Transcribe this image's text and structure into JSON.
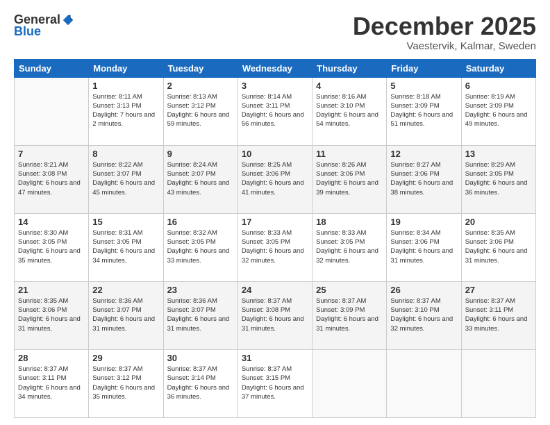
{
  "logo": {
    "general": "General",
    "blue": "Blue"
  },
  "header": {
    "month": "December 2025",
    "location": "Vaestervik, Kalmar, Sweden"
  },
  "weekdays": [
    "Sunday",
    "Monday",
    "Tuesday",
    "Wednesday",
    "Thursday",
    "Friday",
    "Saturday"
  ],
  "weeks": [
    [
      {
        "day": "",
        "sunrise": "",
        "sunset": "",
        "daylight": "",
        "empty": true
      },
      {
        "day": "1",
        "sunrise": "Sunrise: 8:11 AM",
        "sunset": "Sunset: 3:13 PM",
        "daylight": "Daylight: 7 hours and 2 minutes."
      },
      {
        "day": "2",
        "sunrise": "Sunrise: 8:13 AM",
        "sunset": "Sunset: 3:12 PM",
        "daylight": "Daylight: 6 hours and 59 minutes."
      },
      {
        "day": "3",
        "sunrise": "Sunrise: 8:14 AM",
        "sunset": "Sunset: 3:11 PM",
        "daylight": "Daylight: 6 hours and 56 minutes."
      },
      {
        "day": "4",
        "sunrise": "Sunrise: 8:16 AM",
        "sunset": "Sunset: 3:10 PM",
        "daylight": "Daylight: 6 hours and 54 minutes."
      },
      {
        "day": "5",
        "sunrise": "Sunrise: 8:18 AM",
        "sunset": "Sunset: 3:09 PM",
        "daylight": "Daylight: 6 hours and 51 minutes."
      },
      {
        "day": "6",
        "sunrise": "Sunrise: 8:19 AM",
        "sunset": "Sunset: 3:09 PM",
        "daylight": "Daylight: 6 hours and 49 minutes."
      }
    ],
    [
      {
        "day": "7",
        "sunrise": "Sunrise: 8:21 AM",
        "sunset": "Sunset: 3:08 PM",
        "daylight": "Daylight: 6 hours and 47 minutes."
      },
      {
        "day": "8",
        "sunrise": "Sunrise: 8:22 AM",
        "sunset": "Sunset: 3:07 PM",
        "daylight": "Daylight: 6 hours and 45 minutes."
      },
      {
        "day": "9",
        "sunrise": "Sunrise: 8:24 AM",
        "sunset": "Sunset: 3:07 PM",
        "daylight": "Daylight: 6 hours and 43 minutes."
      },
      {
        "day": "10",
        "sunrise": "Sunrise: 8:25 AM",
        "sunset": "Sunset: 3:06 PM",
        "daylight": "Daylight: 6 hours and 41 minutes."
      },
      {
        "day": "11",
        "sunrise": "Sunrise: 8:26 AM",
        "sunset": "Sunset: 3:06 PM",
        "daylight": "Daylight: 6 hours and 39 minutes."
      },
      {
        "day": "12",
        "sunrise": "Sunrise: 8:27 AM",
        "sunset": "Sunset: 3:06 PM",
        "daylight": "Daylight: 6 hours and 38 minutes."
      },
      {
        "day": "13",
        "sunrise": "Sunrise: 8:29 AM",
        "sunset": "Sunset: 3:05 PM",
        "daylight": "Daylight: 6 hours and 36 minutes."
      }
    ],
    [
      {
        "day": "14",
        "sunrise": "Sunrise: 8:30 AM",
        "sunset": "Sunset: 3:05 PM",
        "daylight": "Daylight: 6 hours and 35 minutes."
      },
      {
        "day": "15",
        "sunrise": "Sunrise: 8:31 AM",
        "sunset": "Sunset: 3:05 PM",
        "daylight": "Daylight: 6 hours and 34 minutes."
      },
      {
        "day": "16",
        "sunrise": "Sunrise: 8:32 AM",
        "sunset": "Sunset: 3:05 PM",
        "daylight": "Daylight: 6 hours and 33 minutes."
      },
      {
        "day": "17",
        "sunrise": "Sunrise: 8:33 AM",
        "sunset": "Sunset: 3:05 PM",
        "daylight": "Daylight: 6 hours and 32 minutes."
      },
      {
        "day": "18",
        "sunrise": "Sunrise: 8:33 AM",
        "sunset": "Sunset: 3:05 PM",
        "daylight": "Daylight: 6 hours and 32 minutes."
      },
      {
        "day": "19",
        "sunrise": "Sunrise: 8:34 AM",
        "sunset": "Sunset: 3:06 PM",
        "daylight": "Daylight: 6 hours and 31 minutes."
      },
      {
        "day": "20",
        "sunrise": "Sunrise: 8:35 AM",
        "sunset": "Sunset: 3:06 PM",
        "daylight": "Daylight: 6 hours and 31 minutes."
      }
    ],
    [
      {
        "day": "21",
        "sunrise": "Sunrise: 8:35 AM",
        "sunset": "Sunset: 3:06 PM",
        "daylight": "Daylight: 6 hours and 31 minutes."
      },
      {
        "day": "22",
        "sunrise": "Sunrise: 8:36 AM",
        "sunset": "Sunset: 3:07 PM",
        "daylight": "Daylight: 6 hours and 31 minutes."
      },
      {
        "day": "23",
        "sunrise": "Sunrise: 8:36 AM",
        "sunset": "Sunset: 3:07 PM",
        "daylight": "Daylight: 6 hours and 31 minutes."
      },
      {
        "day": "24",
        "sunrise": "Sunrise: 8:37 AM",
        "sunset": "Sunset: 3:08 PM",
        "daylight": "Daylight: 6 hours and 31 minutes."
      },
      {
        "day": "25",
        "sunrise": "Sunrise: 8:37 AM",
        "sunset": "Sunset: 3:09 PM",
        "daylight": "Daylight: 6 hours and 31 minutes."
      },
      {
        "day": "26",
        "sunrise": "Sunrise: 8:37 AM",
        "sunset": "Sunset: 3:10 PM",
        "daylight": "Daylight: 6 hours and 32 minutes."
      },
      {
        "day": "27",
        "sunrise": "Sunrise: 8:37 AM",
        "sunset": "Sunset: 3:11 PM",
        "daylight": "Daylight: 6 hours and 33 minutes."
      }
    ],
    [
      {
        "day": "28",
        "sunrise": "Sunrise: 8:37 AM",
        "sunset": "Sunset: 3:11 PM",
        "daylight": "Daylight: 6 hours and 34 minutes."
      },
      {
        "day": "29",
        "sunrise": "Sunrise: 8:37 AM",
        "sunset": "Sunset: 3:12 PM",
        "daylight": "Daylight: 6 hours and 35 minutes."
      },
      {
        "day": "30",
        "sunrise": "Sunrise: 8:37 AM",
        "sunset": "Sunset: 3:14 PM",
        "daylight": "Daylight: 6 hours and 36 minutes."
      },
      {
        "day": "31",
        "sunrise": "Sunrise: 8:37 AM",
        "sunset": "Sunset: 3:15 PM",
        "daylight": "Daylight: 6 hours and 37 minutes."
      },
      {
        "day": "",
        "empty": true
      },
      {
        "day": "",
        "empty": true
      },
      {
        "day": "",
        "empty": true
      }
    ]
  ]
}
